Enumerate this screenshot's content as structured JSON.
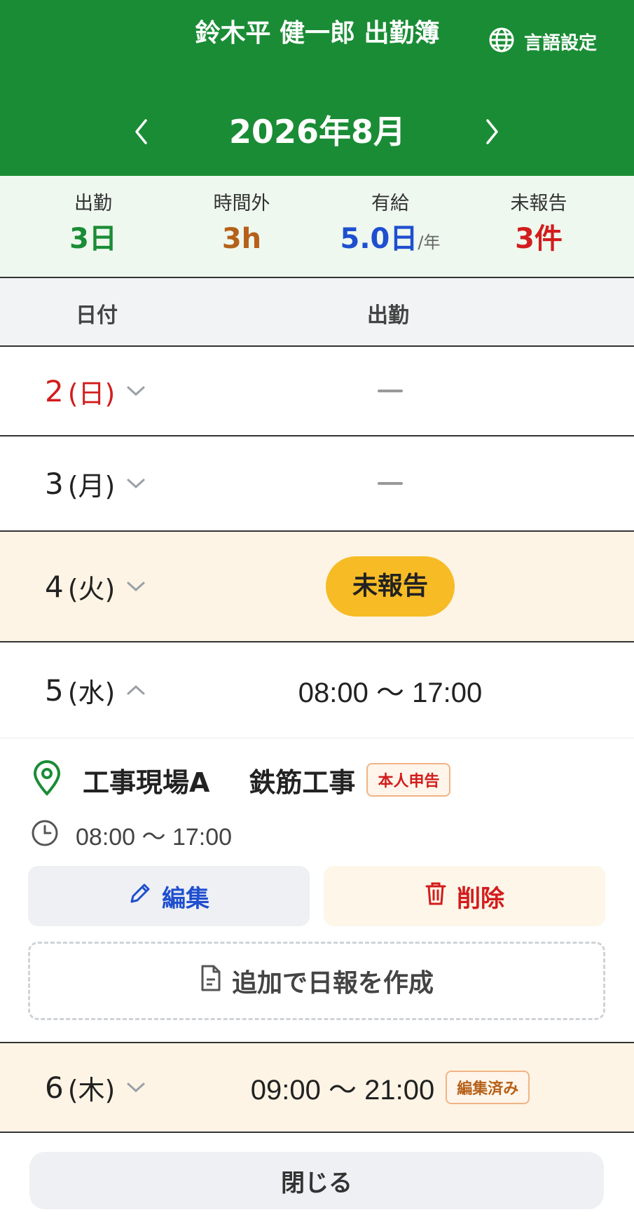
{
  "header": {
    "title": "鈴木平 健一郎 出勤簿",
    "language_label": "言語設定",
    "month_label": "2026年8月",
    "icons": {
      "language": "globe-icon",
      "prev": "chevron-left-icon",
      "next": "chevron-right-icon"
    },
    "color": "#1a8c35"
  },
  "summary": [
    {
      "label": "出勤",
      "value": "3日",
      "unit": "",
      "color": "#1a8c35"
    },
    {
      "label": "時間外",
      "value": "3h",
      "unit": "",
      "color": "#b5611a"
    },
    {
      "label": "有給",
      "value": "5.0日",
      "unit": "/年",
      "color": "#1f4fcf"
    },
    {
      "label": "未報告",
      "value": "3件",
      "unit": "",
      "color": "#d21d1d"
    }
  ],
  "table_header": {
    "date": "日付",
    "attendance": "出勤"
  },
  "rows": [
    {
      "day": "2",
      "dow": "(日)",
      "status": "none",
      "time": "",
      "tag": "",
      "expanded": false,
      "color": "#d21d1d"
    },
    {
      "day": "3",
      "dow": "(月)",
      "status": "none",
      "time": "",
      "tag": "",
      "expanded": false,
      "color": "#222222"
    },
    {
      "day": "4",
      "dow": "(火)",
      "status": "pending",
      "badge": "未報告",
      "expanded": false,
      "color": "#222222"
    },
    {
      "day": "5",
      "dow": "(水)",
      "status": "worked",
      "time": "08:00 〜 17:00",
      "tag": "",
      "expanded": true,
      "color": "#222222"
    },
    {
      "day": "6",
      "dow": "(木)",
      "status": "worked",
      "time": "09:00 〜 21:00",
      "tag": "編集済み",
      "expanded": false,
      "color": "#222222"
    }
  ],
  "detail": {
    "site": "工事現場A",
    "work": "鉄筋工事",
    "tag": "本人申告",
    "time": "08:00 〜 17:00",
    "edit_label": "編集",
    "delete_label": "削除",
    "add_report_label": "追加で日報を作成",
    "icons": {
      "site": "map-pin-icon",
      "time": "clock-icon",
      "edit": "pencil-icon",
      "delete": "trash-icon",
      "add": "document-icon"
    }
  },
  "footer": {
    "close_label": "閉じる"
  }
}
